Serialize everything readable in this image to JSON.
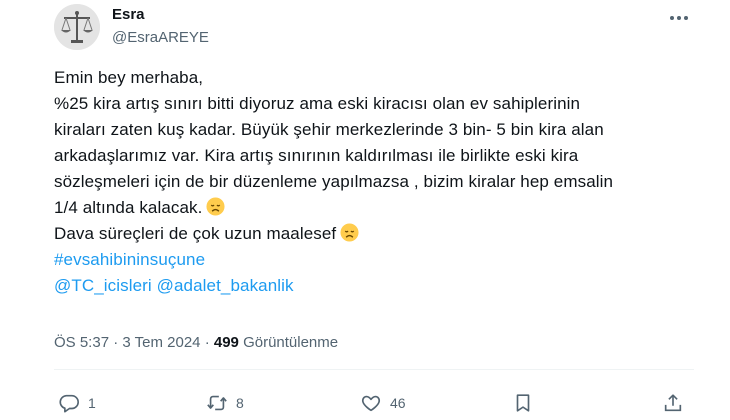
{
  "author": {
    "name": "Esra",
    "handle": "@EsraAREYE"
  },
  "tweet": {
    "lines": [
      "Emin bey merhaba,",
      "%25 kira artış sınırı bitti diyoruz ama eski kiracısı olan ev sahiplerinin",
      "kiraları zaten kuş kadar. Büyük şehir merkezlerinde 3 bin- 5 bin kira alan",
      "arkadaşlarımız var. Kira artış sınırının kaldırılması ile birlikte eski kira",
      "sözleşmeleri için de bir düzenleme yapılmazsa , bizim kiralar hep emsalin",
      "1/4 altında kalacak.",
      "Dava süreçleri de çok uzun maalesef"
    ],
    "hashtag": "#evsahibininsuçune",
    "mentions": [
      "@TC_icisleri",
      "@adalet_bakanlik"
    ]
  },
  "meta": {
    "time": "ÖS 5:37",
    "separator": "·",
    "date": "3 Tem 2024",
    "views_count": "499",
    "views_label": "Görüntülenme"
  },
  "actions": {
    "reply_count": "1",
    "retweet_count": "8",
    "like_count": "46"
  },
  "icons": {
    "more": "more-horizontal-icon",
    "reply": "reply-bubble-icon",
    "retweet": "retweet-icon",
    "like": "heart-icon",
    "bookmark": "bookmark-icon",
    "share": "share-upload-icon",
    "emoji": "disappointed-face-emoji"
  },
  "colors": {
    "link": "#1d9bf0",
    "secondary": "#536471",
    "primary_text": "#0f1419"
  }
}
